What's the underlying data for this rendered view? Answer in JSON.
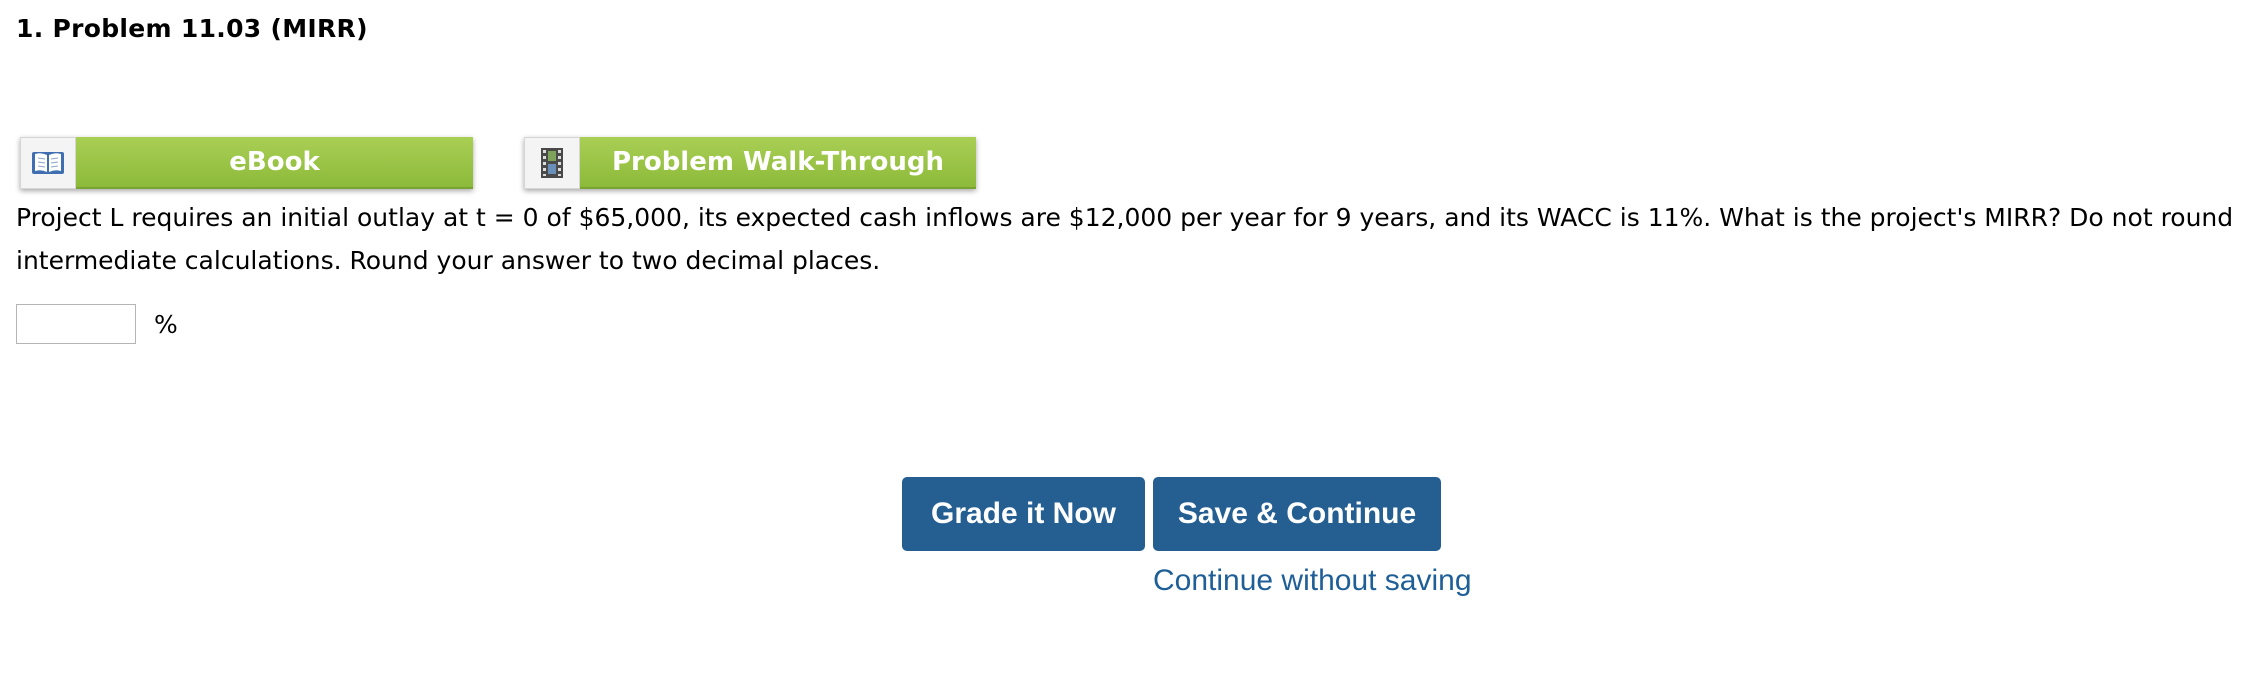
{
  "problem": {
    "title": "1.  Problem 11.03 (MIRR)"
  },
  "toolbar": {
    "ebook_label": "eBook",
    "ebook_icon": "book-icon",
    "walkthrough_label": "Problem Walk-Through",
    "walkthrough_icon": "film-icon",
    "accent_color": "#9bc547"
  },
  "question": {
    "text": "Project L requires an initial outlay at t = 0 of $65,000, its expected cash inflows are $12,000 per year for 9 years, and its WACC is 11%. What is the project's MIRR? Do not round intermediate calculations. Round your answer to two decimal places."
  },
  "answer": {
    "value": "",
    "unit": "%"
  },
  "actions": {
    "grade_label": "Grade it Now",
    "save_label": "Save & Continue",
    "continue_label": "Continue without saving",
    "button_color": "#255f92",
    "link_color": "#1f5f97"
  }
}
